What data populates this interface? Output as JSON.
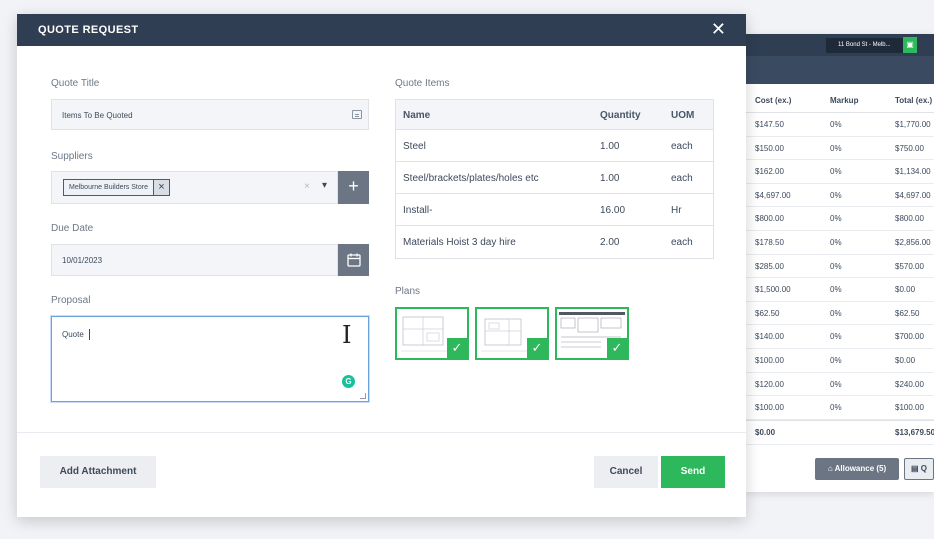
{
  "background_window": {
    "address": "11 Bond St - Melb...",
    "table": {
      "headers": [
        "Cost (ex.)",
        "Markup",
        "Total (ex.)"
      ],
      "rows": [
        [
          "$147.50",
          "0%",
          "$1,770.00"
        ],
        [
          "$150.00",
          "0%",
          "$750.00"
        ],
        [
          "$162.00",
          "0%",
          "$1,134.00"
        ],
        [
          "$4,697.00",
          "0%",
          "$4,697.00"
        ],
        [
          "$800.00",
          "0%",
          "$800.00"
        ],
        [
          "$178.50",
          "0%",
          "$2,856.00"
        ],
        [
          "$285.00",
          "0%",
          "$570.00"
        ],
        [
          "$1,500.00",
          "0%",
          "$0.00"
        ],
        [
          "$62.50",
          "0%",
          "$62.50"
        ],
        [
          "$140.00",
          "0%",
          "$700.00"
        ],
        [
          "$100.00",
          "0%",
          "$0.00"
        ],
        [
          "$120.00",
          "0%",
          "$240.00"
        ],
        [
          "$100.00",
          "0%",
          "$100.00"
        ]
      ],
      "totals": [
        "$0.00",
        "",
        "$13,679.50"
      ]
    },
    "allowance_label": "Allowance (5)",
    "q_label": "Q"
  },
  "modal": {
    "title": "QUOTE REQUEST",
    "close": "✕",
    "quote_title": {
      "label": "Quote Title",
      "value": "Items To Be Quoted"
    },
    "suppliers": {
      "label": "Suppliers",
      "chip": "Melbourne Builders Store",
      "clear": "×",
      "chevron": "⌄",
      "add": "+"
    },
    "due_date": {
      "label": "Due Date",
      "value": "10/01/2023"
    },
    "proposal": {
      "label": "Proposal",
      "value": "Quote",
      "grammarly": "G"
    },
    "quote_items": {
      "label": "Quote Items",
      "headers": [
        "Name",
        "Quantity",
        "UOM"
      ],
      "rows": [
        {
          "name": "Steel",
          "qty": "1.00",
          "uom": "each"
        },
        {
          "name": "Steel/brackets/plates/holes etc",
          "qty": "1.00",
          "uom": "each"
        },
        {
          "name": "Install-",
          "qty": "16.00",
          "uom": "Hr"
        },
        {
          "name": "Materials Hoist 3 day hire",
          "qty": "2.00",
          "uom": "each"
        }
      ]
    },
    "plans": {
      "label": "Plans",
      "count": 3,
      "check": "✓"
    },
    "buttons": {
      "attach": "Add Attachment",
      "cancel": "Cancel",
      "send": "Send"
    }
  },
  "colors": {
    "header": "#2f3e52",
    "accent_green": "#2eb85c",
    "gray_button": "#6b7584"
  },
  "icons": [
    "close-icon",
    "form-icon",
    "clear-icon",
    "chevron-down-icon",
    "plus-icon",
    "calendar-icon",
    "text-cursor-icon",
    "grammarly-icon",
    "checkmark-icon",
    "tag-icon"
  ]
}
